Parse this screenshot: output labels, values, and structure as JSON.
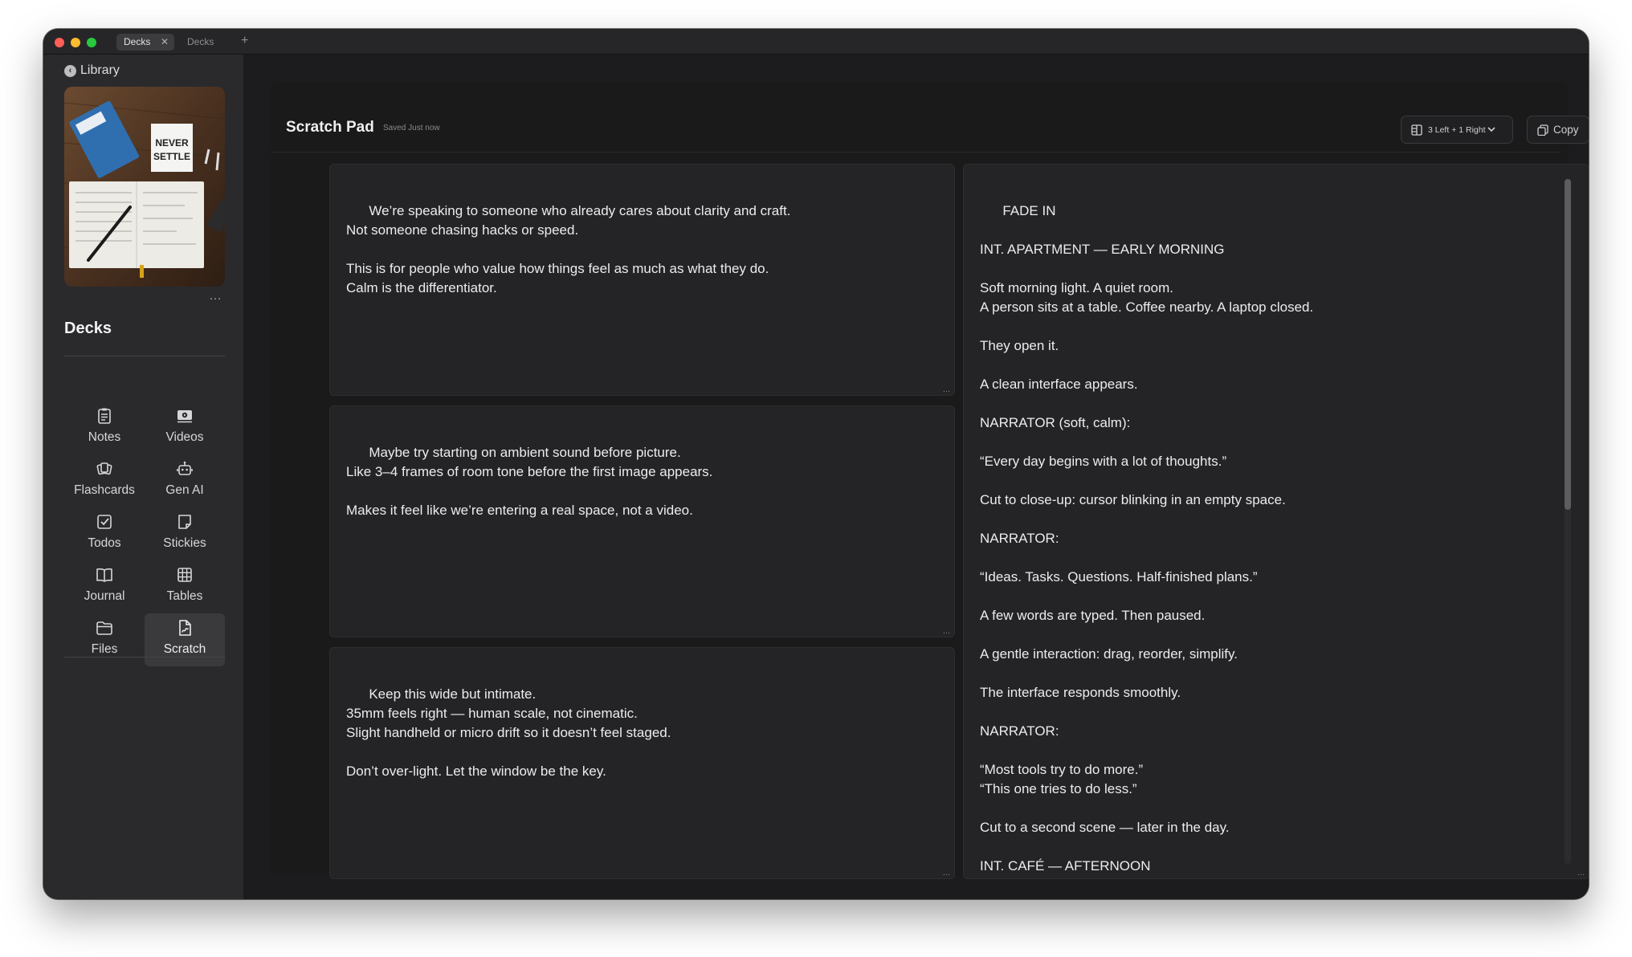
{
  "window": {
    "tabs": [
      {
        "label": "Decks",
        "close": "✕"
      },
      {
        "label": "Decks"
      }
    ],
    "new_tab": "+"
  },
  "sidebar": {
    "back_label": "Library",
    "cover_more": "…",
    "section_title": "Decks",
    "items": [
      {
        "label": "Notes",
        "icon": "notes-icon"
      },
      {
        "label": "Videos",
        "icon": "videos-icon"
      },
      {
        "label": "Flashcards",
        "icon": "flashcards-icon"
      },
      {
        "label": "Gen AI",
        "icon": "gen-ai-icon"
      },
      {
        "label": "Todos",
        "icon": "todos-icon"
      },
      {
        "label": "Stickies",
        "icon": "stickies-icon"
      },
      {
        "label": "Journal",
        "icon": "journal-icon"
      },
      {
        "label": "Tables",
        "icon": "tables-icon"
      },
      {
        "label": "Files",
        "icon": "files-icon"
      },
      {
        "label": "Scratch",
        "icon": "scratch-icon",
        "active": true
      }
    ]
  },
  "header": {
    "title": "Scratch Pad",
    "saved_status": "Saved Just now",
    "layout_label": "3 Left + 1 Right",
    "copy_label": "Copy"
  },
  "notes": [
    {
      "text": "We’re speaking to someone who already cares about clarity and craft.\nNot someone chasing hacks or speed.\n\nThis is for people who value how things feel as much as what they do.\nCalm is the differentiator."
    },
    {
      "text": "Maybe try starting on ambient sound before picture.\nLike 3–4 frames of room tone before the first image appears.\n\nMakes it feel like we’re entering a real space, not a video."
    },
    {
      "text": "Keep this wide but intimate.\n35mm feels right — human scale, not cinematic.\nSlight handheld or micro drift so it doesn’t feel staged.\n\nDon’t over-light. Let the window be the key."
    },
    {
      "text": "FADE IN\n\nINT. APARTMENT — EARLY MORNING\n\nSoft morning light. A quiet room.\nA person sits at a table. Coffee nearby. A laptop closed.\n\nThey open it.\n\nA clean interface appears.\n\nNARRATOR (soft, calm):\n\n“Every day begins with a lot of thoughts.”\n\nCut to close-up: cursor blinking in an empty space.\n\nNARRATOR:\n\n“Ideas. Tasks. Questions. Half-finished plans.”\n\nA few words are typed. Then paused.\n\nA gentle interaction: drag, reorder, simplify.\n\nThe interface responds smoothly.\n\nNARRATOR:\n\n“Most tools try to do more.”\n“This one tries to do less.”\n\nCut to a second scene — later in the day.\n\nINT. CAFÉ — AFTERNOON"
    }
  ],
  "resize_glyph": "…",
  "colors": {
    "accent_red": "#ff5f57",
    "accent_yellow": "#febc2e",
    "accent_green": "#28c840",
    "background": "#1c1c1e",
    "sidebar": "#2a2a2c"
  }
}
